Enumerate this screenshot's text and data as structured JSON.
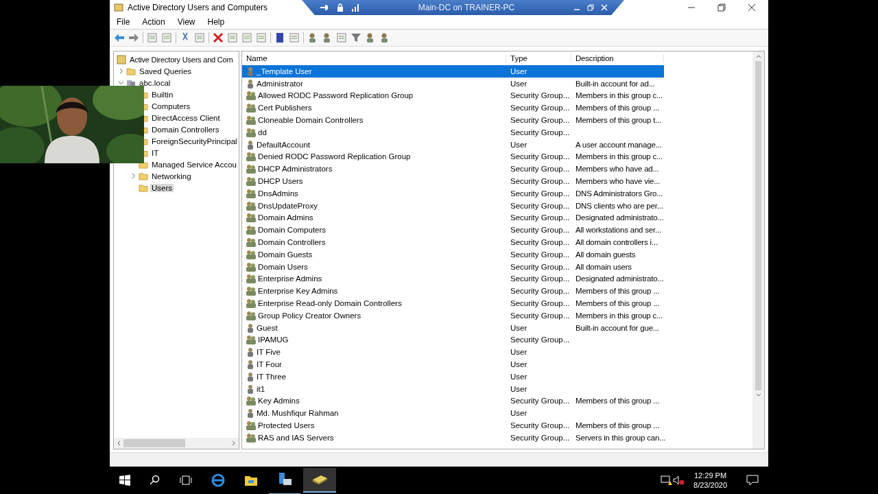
{
  "window": {
    "title": "Active Directory Users and Computers"
  },
  "remote_bar": {
    "title": "Main-DC on TRAINER-PC"
  },
  "menu": [
    "File",
    "Action",
    "View",
    "Help"
  ],
  "tree": {
    "label": "Active Directory Users and Com",
    "children": [
      {
        "label": "Saved Queries",
        "expanded": false,
        "selected": false
      },
      {
        "label": "abc.local",
        "expanded": true,
        "selected": false,
        "children": [
          {
            "label": "Builtin",
            "selected": false
          },
          {
            "label": "Computers",
            "selected": false
          },
          {
            "label": "DirectAccess Client",
            "selected": false
          },
          {
            "label": "Domain Controllers",
            "selected": false
          },
          {
            "label": "ForeignSecurityPrincipal",
            "selected": false
          },
          {
            "label": "IT",
            "selected": false
          },
          {
            "label": "Managed Service Accou",
            "selected": false
          },
          {
            "label": "Networking",
            "expanded": false,
            "selected": false
          },
          {
            "label": "Users",
            "selected": true
          }
        ]
      }
    ]
  },
  "table": {
    "columns": [
      "Name",
      "Type",
      "Description"
    ],
    "rows": [
      {
        "kind": "user",
        "name": "_Template User",
        "type": "User",
        "description": "",
        "selected": true
      },
      {
        "kind": "user",
        "name": "Administrator",
        "type": "User",
        "description": "Built-in account for ad...",
        "selected": false
      },
      {
        "kind": "group",
        "name": "Allowed RODC Password Replication Group",
        "type": "Security Group...",
        "description": "Members in this group c...",
        "selected": false
      },
      {
        "kind": "group",
        "name": "Cert Publishers",
        "type": "Security Group...",
        "description": "Members of this group ...",
        "selected": false
      },
      {
        "kind": "group",
        "name": "Cloneable Domain Controllers",
        "type": "Security Group...",
        "description": "Members of this group t...",
        "selected": false
      },
      {
        "kind": "group",
        "name": "dd",
        "type": "Security Group...",
        "description": "",
        "selected": false
      },
      {
        "kind": "user",
        "name": "DefaultAccount",
        "type": "User",
        "description": "A user account manage...",
        "selected": false
      },
      {
        "kind": "group",
        "name": "Denied RODC Password Replication Group",
        "type": "Security Group...",
        "description": "Members in this group c...",
        "selected": false
      },
      {
        "kind": "group",
        "name": "DHCP Administrators",
        "type": "Security Group...",
        "description": "Members who have ad...",
        "selected": false
      },
      {
        "kind": "group",
        "name": "DHCP Users",
        "type": "Security Group...",
        "description": "Members who have vie...",
        "selected": false
      },
      {
        "kind": "group",
        "name": "DnsAdmins",
        "type": "Security Group...",
        "description": "DNS Administrators Gro...",
        "selected": false
      },
      {
        "kind": "group",
        "name": "DnsUpdateProxy",
        "type": "Security Group...",
        "description": "DNS clients who are per...",
        "selected": false
      },
      {
        "kind": "group",
        "name": "Domain Admins",
        "type": "Security Group...",
        "description": "Designated administrato...",
        "selected": false
      },
      {
        "kind": "group",
        "name": "Domain Computers",
        "type": "Security Group...",
        "description": "All workstations and ser...",
        "selected": false
      },
      {
        "kind": "group",
        "name": "Domain Controllers",
        "type": "Security Group...",
        "description": "All domain controllers i...",
        "selected": false
      },
      {
        "kind": "group",
        "name": "Domain Guests",
        "type": "Security Group...",
        "description": "All domain guests",
        "selected": false
      },
      {
        "kind": "group",
        "name": "Domain Users",
        "type": "Security Group...",
        "description": "All domain users",
        "selected": false
      },
      {
        "kind": "group",
        "name": "Enterprise Admins",
        "type": "Security Group...",
        "description": "Designated administrato...",
        "selected": false
      },
      {
        "kind": "group",
        "name": "Enterprise Key Admins",
        "type": "Security Group...",
        "description": "Members of this group ...",
        "selected": false
      },
      {
        "kind": "group",
        "name": "Enterprise Read-only Domain Controllers",
        "type": "Security Group...",
        "description": "Members of this group ...",
        "selected": false
      },
      {
        "kind": "group",
        "name": "Group Policy Creator Owners",
        "type": "Security Group...",
        "description": "Members in this group c...",
        "selected": false
      },
      {
        "kind": "user",
        "name": "Guest",
        "type": "User",
        "description": "Built-in account for gue...",
        "selected": false
      },
      {
        "kind": "group",
        "name": "IPAMUG",
        "type": "Security Group...",
        "description": "",
        "selected": false
      },
      {
        "kind": "user",
        "name": "IT Five",
        "type": "User",
        "description": "",
        "selected": false
      },
      {
        "kind": "user",
        "name": "IT Four",
        "type": "User",
        "description": "",
        "selected": false
      },
      {
        "kind": "user",
        "name": "IT Three",
        "type": "User",
        "description": "",
        "selected": false
      },
      {
        "kind": "user",
        "name": "it1",
        "type": "User",
        "description": "",
        "selected": false
      },
      {
        "kind": "group",
        "name": "Key Admins",
        "type": "Security Group...",
        "description": "Members of this group ...",
        "selected": false
      },
      {
        "kind": "user",
        "name": "Md. Mushfiqur Rahman",
        "type": "User",
        "description": "",
        "selected": false
      },
      {
        "kind": "group",
        "name": "Protected Users",
        "type": "Security Group...",
        "description": "Members of this group ...",
        "selected": false
      },
      {
        "kind": "group",
        "name": "RAS and IAS Servers",
        "type": "Security Group...",
        "description": "Servers in this group can...",
        "selected": false
      }
    ]
  },
  "clock": {
    "time": "12:29 PM",
    "date": "8/23/2020"
  }
}
